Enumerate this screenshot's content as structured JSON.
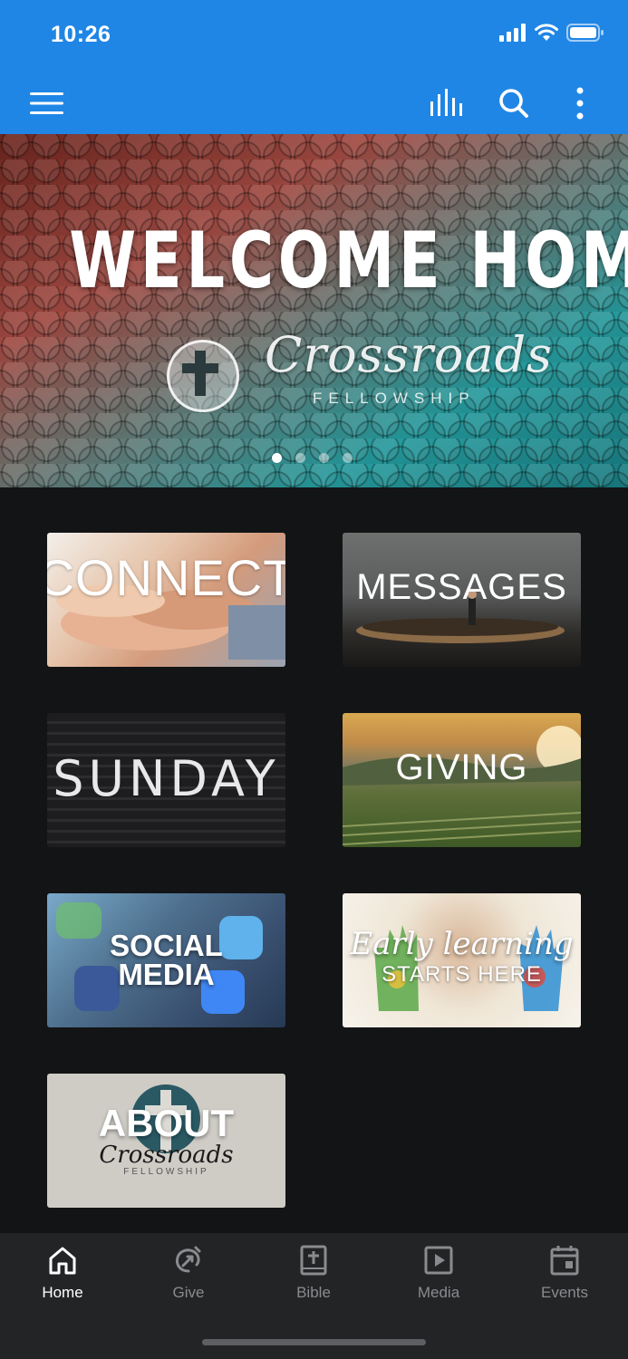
{
  "status_bar": {
    "time": "10:26"
  },
  "app_bar": {
    "menu_icon": "hamburger-menu-icon",
    "actions": [
      "bar-chart-icon",
      "search-icon",
      "more-vertical-icon"
    ]
  },
  "hero": {
    "title": "WELCOME HOME",
    "brand": "Crossroads",
    "brand_sub": "FELLOWSHIP",
    "slide_count": 4,
    "active_slide": 1
  },
  "tiles": [
    {
      "label": "CONNECT"
    },
    {
      "label": "MESSAGES"
    },
    {
      "label": "SUNDAY"
    },
    {
      "label": "GIVING"
    },
    {
      "label_line1": "SOCIAL",
      "label_line2": "MEDIA"
    },
    {
      "label_line1": "Early learning",
      "label_line2": "STARTS HERE"
    },
    {
      "label": "ABOUT",
      "brand": "Crossroads",
      "brand_sub": "FELLOWSHIP"
    }
  ],
  "bottom_nav": [
    {
      "label": "Home",
      "icon": "home-icon",
      "active": true
    },
    {
      "label": "Give",
      "icon": "give-icon",
      "active": false
    },
    {
      "label": "Bible",
      "icon": "bible-icon",
      "active": false
    },
    {
      "label": "Media",
      "icon": "media-play-icon",
      "active": false
    },
    {
      "label": "Events",
      "icon": "calendar-icon",
      "active": false
    }
  ],
  "colors": {
    "primary": "#1f86e6",
    "background": "#131416",
    "nav_background": "#232426",
    "nav_inactive": "#8a8b8e"
  }
}
